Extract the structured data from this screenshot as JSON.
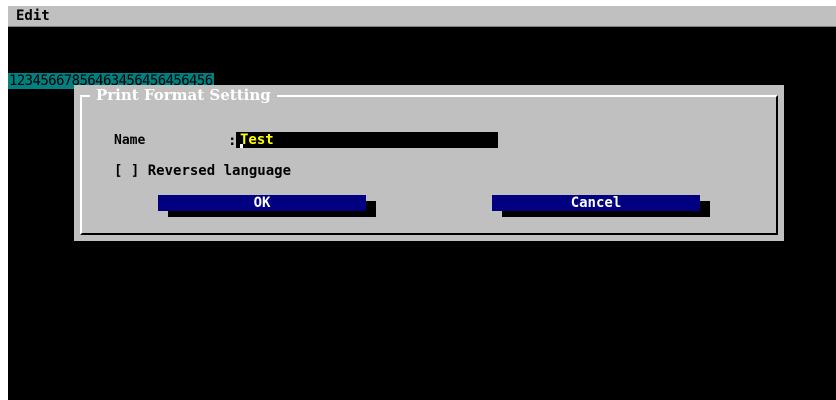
{
  "menubar": {
    "edit_label": "Edit"
  },
  "background_text": "1234566785646345645645б456",
  "dialog": {
    "title": "Print Format Setting",
    "name_label": "Name",
    "name_colon": ":",
    "name_value": "Test",
    "checkbox_box": "[ ]",
    "checkbox_label": "Reversed language",
    "ok_label": "OK",
    "cancel_label": "Cancel"
  },
  "colors": {
    "screen_bg": "#000000",
    "dialog_bg": "#c0c0c0",
    "button_bg": "#000080",
    "field_text": "#ffff00",
    "text_line_bg": "#008080"
  }
}
